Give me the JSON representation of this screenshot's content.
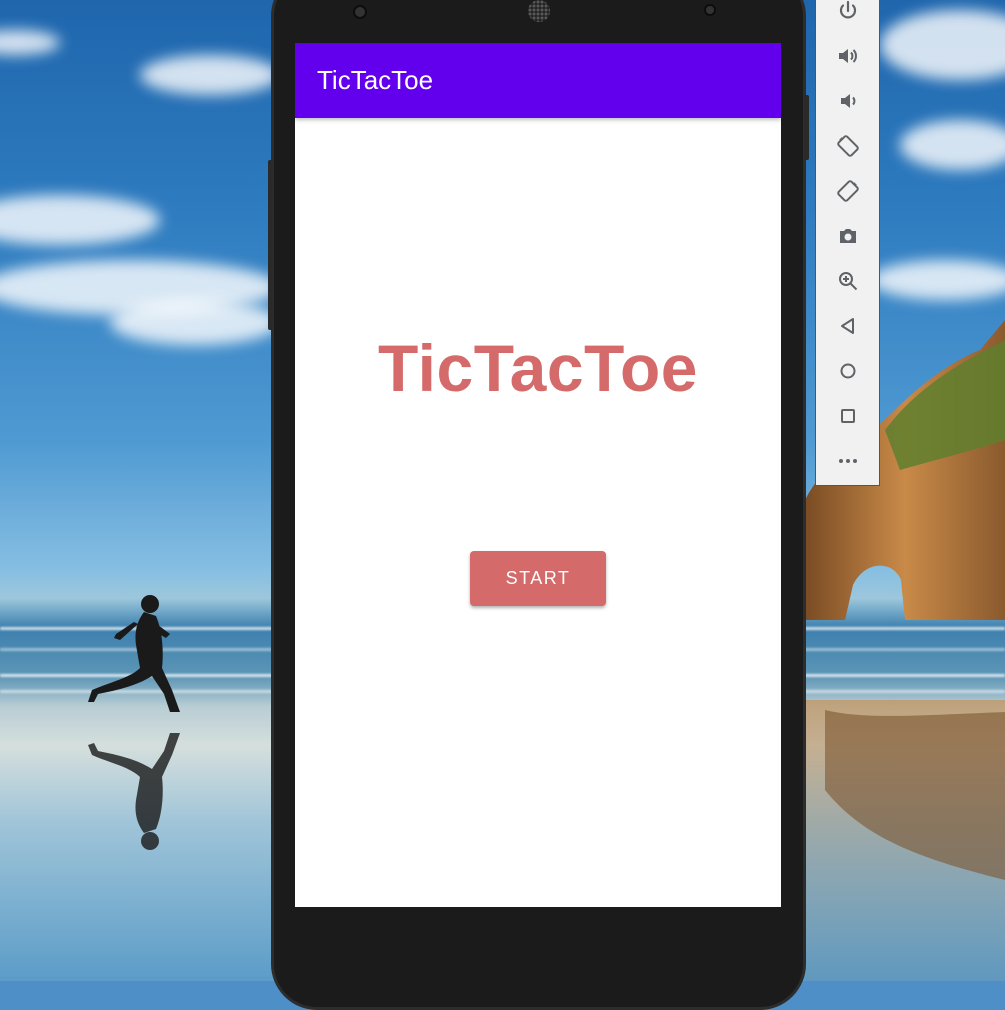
{
  "app": {
    "title": "TicTacToe",
    "heading": "TicTacToe",
    "start_label": "START"
  },
  "colors": {
    "app_bar": "#6200ee",
    "accent": "#d46a6a",
    "screen_bg": "#ffffff",
    "toolbar_bg": "#f1f1f1"
  },
  "emulator_toolbar": {
    "icons": [
      "power-icon",
      "volume-up-icon",
      "volume-down-icon",
      "rotate-left-icon",
      "rotate-right-icon",
      "camera-icon",
      "zoom-icon",
      "back-icon",
      "home-icon",
      "overview-icon",
      "more-icon"
    ]
  }
}
